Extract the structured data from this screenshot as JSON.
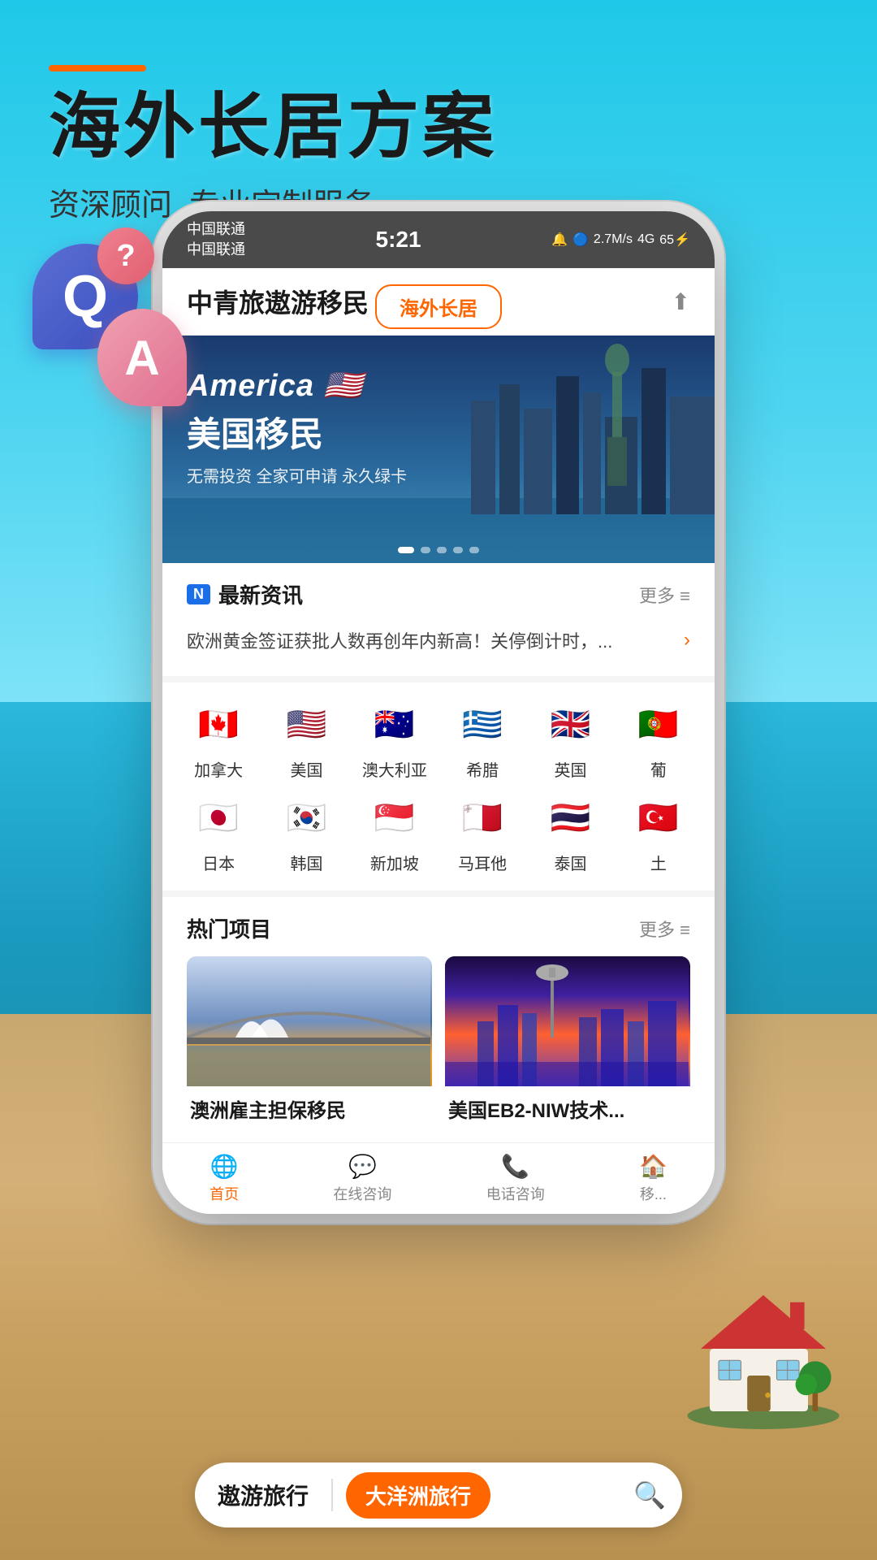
{
  "background": {
    "gradient_start": "#29c4e8",
    "gradient_end": "#d4a96a"
  },
  "header": {
    "accent_line": true,
    "title": "海外长居方案",
    "subtitle": "资深顾问, 专业定制服务"
  },
  "banner_tag": "海外长居",
  "status_bar": {
    "carrier1": "中国联通",
    "carrier2": "中国联通",
    "time": "5:21",
    "signal_info": "2.7 M/s 4G 46 65"
  },
  "app_header": {
    "title": "中青旅遨游移民",
    "share_label": "⬆"
  },
  "hero": {
    "main_text": "America 🇺🇸",
    "sub_text": "美国移民",
    "desc": "无需投资 全家可申请 永久绿卡",
    "dots": [
      "active",
      "inactive",
      "inactive",
      "inactive",
      "inactive"
    ]
  },
  "news": {
    "badge": "N",
    "title": "最新资讯",
    "more": "更多 ≡",
    "item": "欧洲黄金签证获批人数再创年内新高！关停倒计时，..."
  },
  "countries": [
    {
      "flag": "🇨🇦",
      "name": "加拿大"
    },
    {
      "flag": "🇺🇸",
      "name": "美国"
    },
    {
      "flag": "🇦🇺",
      "name": "澳大利亚"
    },
    {
      "flag": "🇬🇷",
      "name": "希腊"
    },
    {
      "flag": "🇬🇧",
      "name": "英国"
    },
    {
      "flag": "🇵🇹",
      "name": "葡"
    },
    {
      "flag": "🇯🇵",
      "name": "日本"
    },
    {
      "flag": "🇰🇷",
      "name": "韩国"
    },
    {
      "flag": "🇸🇬",
      "name": "新加坡"
    },
    {
      "flag": "🇲🇹",
      "name": "马耳他"
    },
    {
      "flag": "🇹🇭",
      "name": "泰国"
    },
    {
      "flag": "🇹🇷",
      "name": "土"
    }
  ],
  "projects": {
    "title": "热门项目",
    "more": "更多 ≡",
    "items": [
      {
        "title": "澳洲雇主担保移民"
      },
      {
        "title": "美国EB2-NIW技术..."
      }
    ]
  },
  "bottom_nav": [
    {
      "icon": "🌐",
      "label": "首页",
      "active": true
    },
    {
      "icon": "💬",
      "label": "在线咨询",
      "active": false
    },
    {
      "icon": "📞",
      "label": "电话咨询",
      "active": false
    },
    {
      "icon": "🏠",
      "label": "移...",
      "active": false
    }
  ],
  "bottom_search": {
    "brand": "遨游旅行",
    "tag": "大洋洲旅行",
    "icon": "🔍"
  }
}
